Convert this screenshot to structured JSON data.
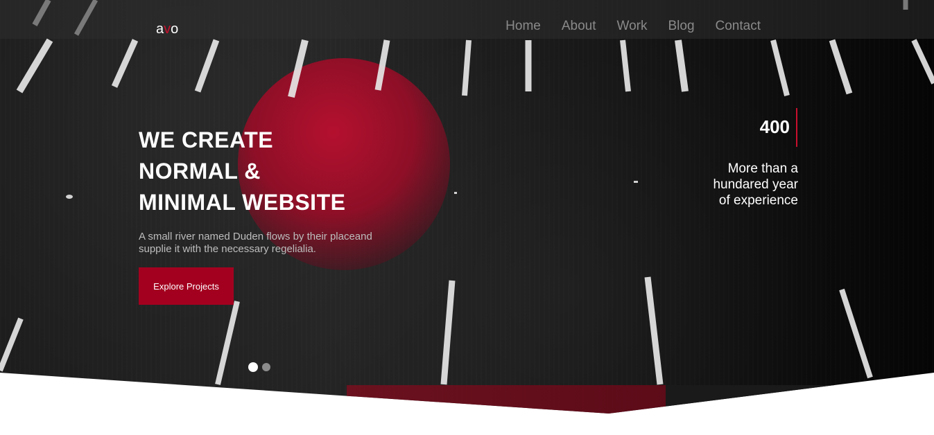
{
  "logo": {
    "text_before": "a",
    "text_accent": "v",
    "text_after": "o"
  },
  "nav": {
    "items": [
      "Home",
      "About",
      "Work",
      "Blog",
      "Contact"
    ]
  },
  "hero": {
    "headline_lines": [
      "WE CREATE",
      "NORMAL &",
      "MINIMAL WEBSITE"
    ],
    "subtext": "A small river named Duden flows by their placeand supplie it with the necessary regelialia.",
    "cta_label": "Explore Projects",
    "slider": {
      "count": 2,
      "active_index": 0
    }
  },
  "stat": {
    "number": "400",
    "label": "More than a hundared year of experience"
  },
  "colors": {
    "accent": "#c8102e",
    "button": "#a3001f",
    "nav_text": "#8a8a8a"
  }
}
